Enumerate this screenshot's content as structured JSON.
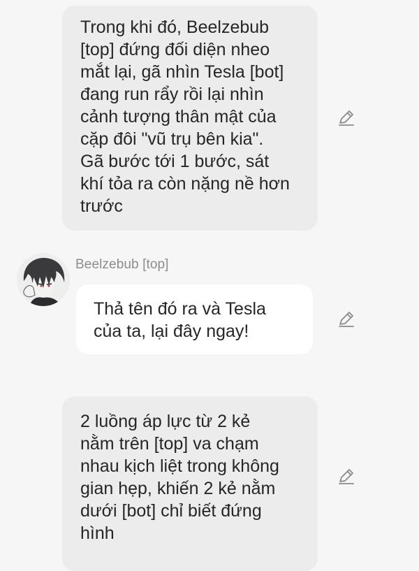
{
  "messages": [
    {
      "type": "narration",
      "text": "Trong khi đó, Beelzebub\n[top] đứng đối diện nheo\nmắt lại, gã nhìn Tesla [bot]\nđang run rẩy rồi lại nhìn\ncảnh tượng thân mật của\ncặp đôi \"vũ trụ bên kia\".\nGã bước tới 1 bước, sát\nkhí tỏa ra còn nặng nề hơn\ntrước"
    },
    {
      "type": "character",
      "sender": "Beelzebub [top]",
      "text": "Thả tên đó ra và Tesla\ncủa ta, lại đây ngay!"
    },
    {
      "type": "narration",
      "text": "2 luồng áp lực từ 2 kẻ\nnằm trên [top] va chạm\nnhau kịch liệt trong không\ngian hẹp, khiến 2 kẻ nằm\ndưới [bot] chỉ biết đứng\nhình"
    }
  ],
  "icons": {
    "edit": "pencil-icon",
    "avatar": "character-avatar"
  },
  "colors": {
    "background": "#f6f6f6",
    "narration_bubble": "#ececec",
    "speech_bubble": "#ffffff",
    "text": "#262626",
    "sender": "#8c8c8c",
    "icon": "#8a8a8a"
  }
}
